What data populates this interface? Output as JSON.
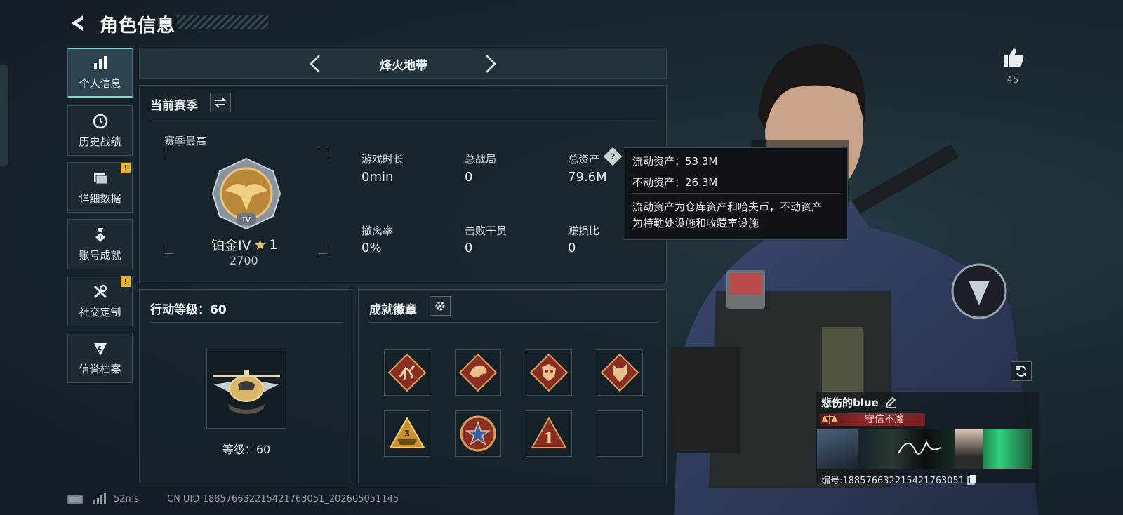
{
  "header": {
    "title": "角色信息"
  },
  "sidebar": {
    "items": [
      {
        "label": "个人信息",
        "icon": "bar-chart-icon",
        "active": true,
        "alert": false
      },
      {
        "label": "历史战绩",
        "icon": "history-clock-icon",
        "active": false,
        "alert": false
      },
      {
        "label": "详细数据",
        "icon": "folder-icon",
        "active": false,
        "alert": true
      },
      {
        "label": "账号成就",
        "icon": "medal-icon",
        "active": false,
        "alert": false
      },
      {
        "label": "社交定制",
        "icon": "tools-icon",
        "active": false,
        "alert": true
      },
      {
        "label": "信誉档案",
        "icon": "reputation-shield-icon",
        "active": false,
        "alert": false
      }
    ],
    "alert_mark": "!"
  },
  "mode": {
    "label": "烽火地带"
  },
  "season": {
    "title": "当前赛季",
    "best_label": "赛季最高",
    "rank_name": "铂金IV",
    "rank_stars": "1",
    "rank_score": "2700",
    "rank_emblem_numeral": "IV",
    "stats": [
      {
        "label": "游戏时长",
        "value": "0min"
      },
      {
        "label": "总战局",
        "value": "0"
      },
      {
        "label": "总资产",
        "value": "79.6M"
      },
      {
        "label": "撤离率",
        "value": "0%"
      },
      {
        "label": "击败干员",
        "value": "0"
      },
      {
        "label": "赚损比",
        "value": "0"
      }
    ]
  },
  "tooltip": {
    "liquid": "流动资产：53.3M",
    "fixed": "不动资产：26.3M",
    "desc_line1": "流动资产为仓库资产和哈夫币，不动资产",
    "desc_line2": "为特勤处设施和收藏室设施"
  },
  "action_level": {
    "title": "行动等级：60",
    "level_text": "等级：60"
  },
  "achievements": {
    "title": "成就徽章",
    "badges": [
      {
        "name": "runner-badge-icon"
      },
      {
        "name": "dragon-badge-icon"
      },
      {
        "name": "dragon-head-badge-icon"
      },
      {
        "name": "wolf-badge-icon"
      },
      {
        "name": "triangle-chevron-badge-icon"
      },
      {
        "name": "star-seal-badge-icon"
      },
      {
        "name": "number-one-badge-icon"
      },
      {
        "name": "empty-badge-slot"
      }
    ],
    "badge_numerals": {
      "triangle": "3",
      "one": "1"
    }
  },
  "likes": {
    "count": "45"
  },
  "player": {
    "name": "悲伤的blue",
    "title": "守信不渝",
    "uid_label": "编号:1885766322154217630​51"
  },
  "footer": {
    "ping": "52ms",
    "uid": "CN UID:1885766322154217630​51_202605051145"
  },
  "colors": {
    "accent": "#7fe0c8",
    "alert": "#e8b22e",
    "title_banner": "#7a2020",
    "card_green": "#2fd17a"
  }
}
